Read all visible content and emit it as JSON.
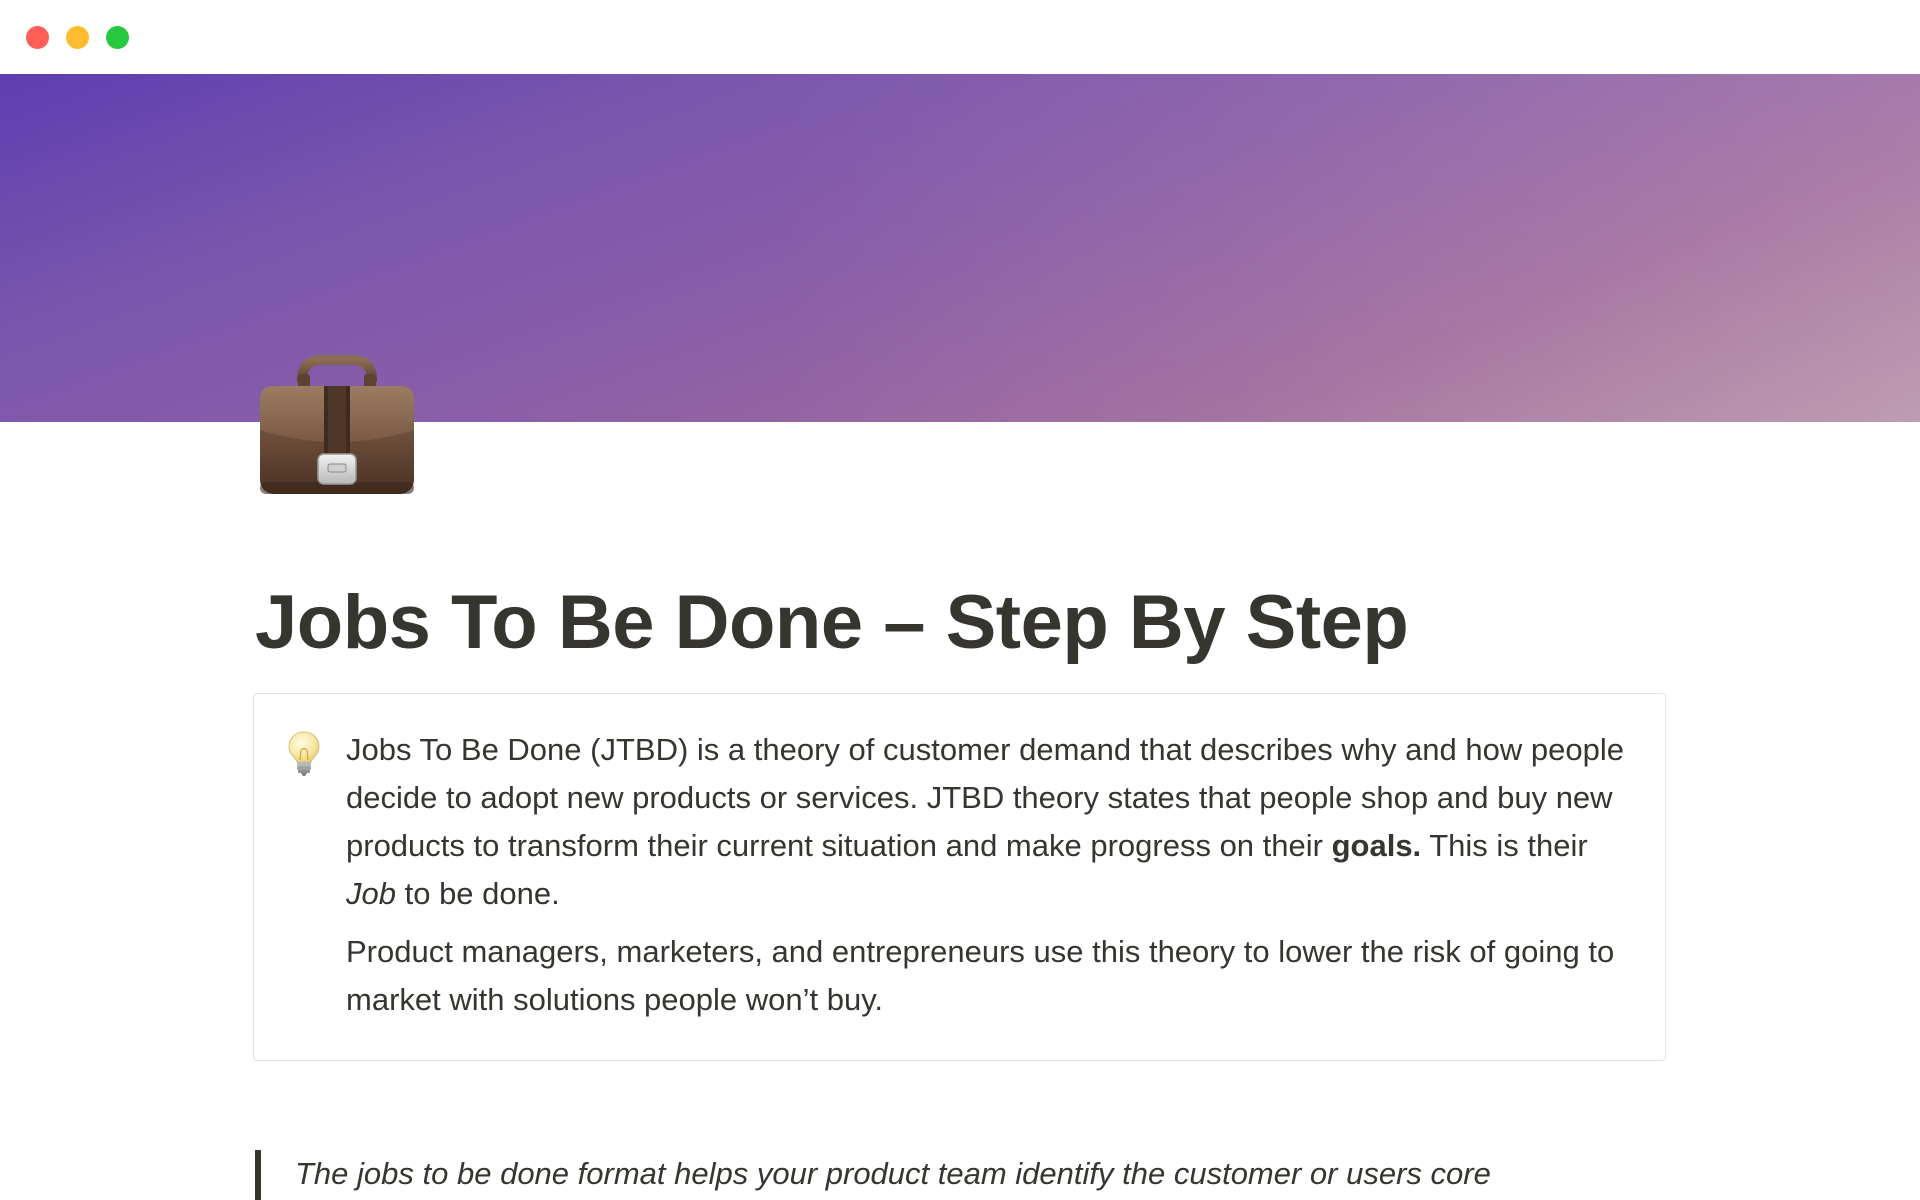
{
  "window": {
    "controls": [
      "close",
      "minimize",
      "maximize"
    ]
  },
  "page": {
    "icon": "briefcase-icon",
    "title": "Jobs To Be Done – Step By Step"
  },
  "callout": {
    "icon": "lightbulb-icon",
    "paragraph1": {
      "part1": "Jobs To Be Done (JTBD) is a theory of customer demand that describes why and how people decide to adopt new products or services. JTBD theory states that people shop and buy new products to transform their current situation and make progress on their ",
      "bold": "goals.",
      "part2": " This is their ",
      "italic": "Job",
      "part3": " to be done."
    },
    "paragraph2": "Product managers, marketers, and entrepreneurs use this theory to lower the risk of going to market with solutions people won’t buy."
  },
  "quote": {
    "text": "The jobs to be done format helps your product team identify the customer or users core"
  },
  "colors": {
    "text": "#37352f",
    "border": "#e3e2e0",
    "cover_start": "#5e3eb0",
    "cover_end": "#b58fa6"
  }
}
